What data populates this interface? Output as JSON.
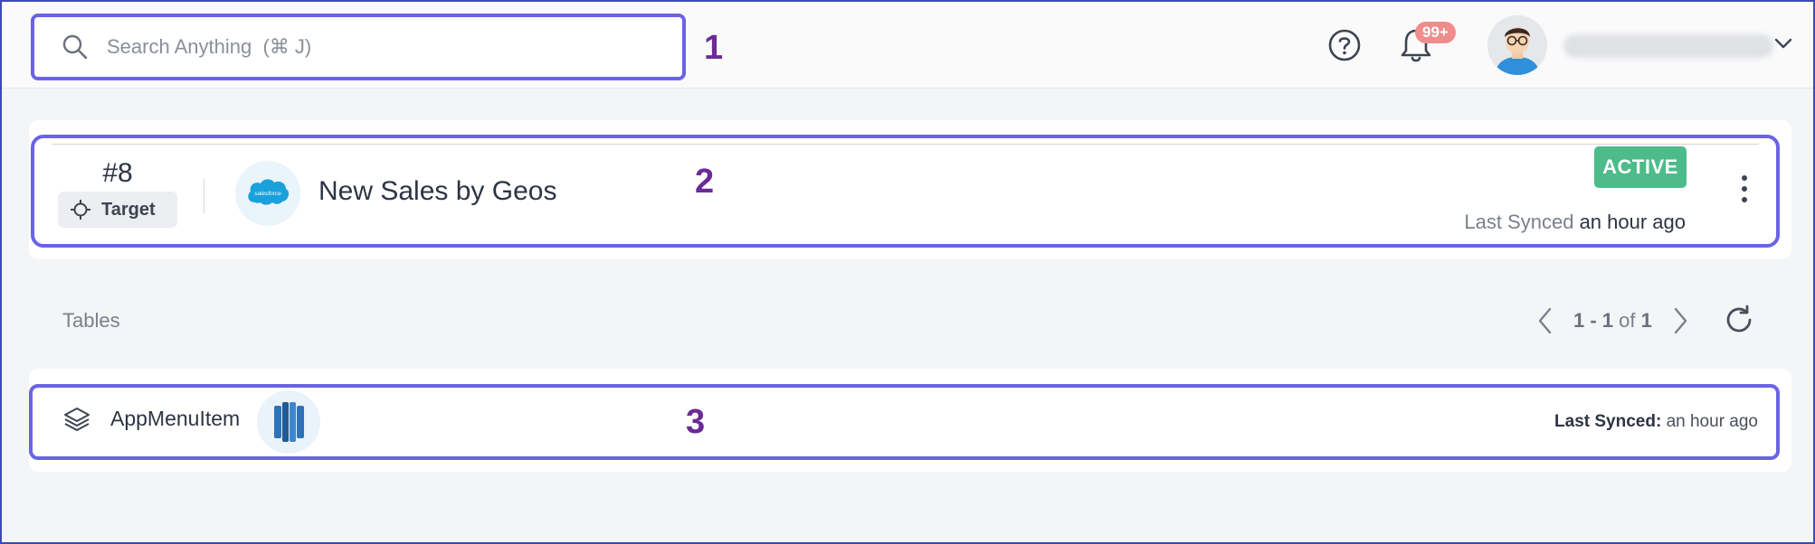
{
  "header": {
    "search": {
      "placeholder": "Search Anything  (⌘ J)",
      "value": ""
    },
    "help_icon": "question-circle-icon",
    "bell_icon": "bell-icon",
    "notifications_badge": "99+",
    "user_chevron_icon": "chevron-down-icon"
  },
  "annotations": {
    "one": "1",
    "two": "2",
    "three": "3"
  },
  "model": {
    "number": "#8",
    "type_label": "Target",
    "source_logo": "salesforce",
    "title": "New Sales by Geos",
    "status": "ACTIVE",
    "synced_label": "Last Synced",
    "synced_value": "an hour ago"
  },
  "tables": {
    "label": "Tables",
    "pagination": {
      "range": "1 - 1",
      "of_word": "of",
      "total": "1"
    },
    "rows": [
      {
        "name": "AppMenuItem",
        "logo": "redshift",
        "synced_label": "Last Synced:",
        "synced_value": "an hour ago"
      }
    ]
  },
  "colors": {
    "highlight_border": "#6b63e3",
    "annotation_number": "#6a2b96",
    "active_badge": "#4dbb8a",
    "notification_badge": "#f08c8c",
    "page_background": "#f4f5f7"
  }
}
